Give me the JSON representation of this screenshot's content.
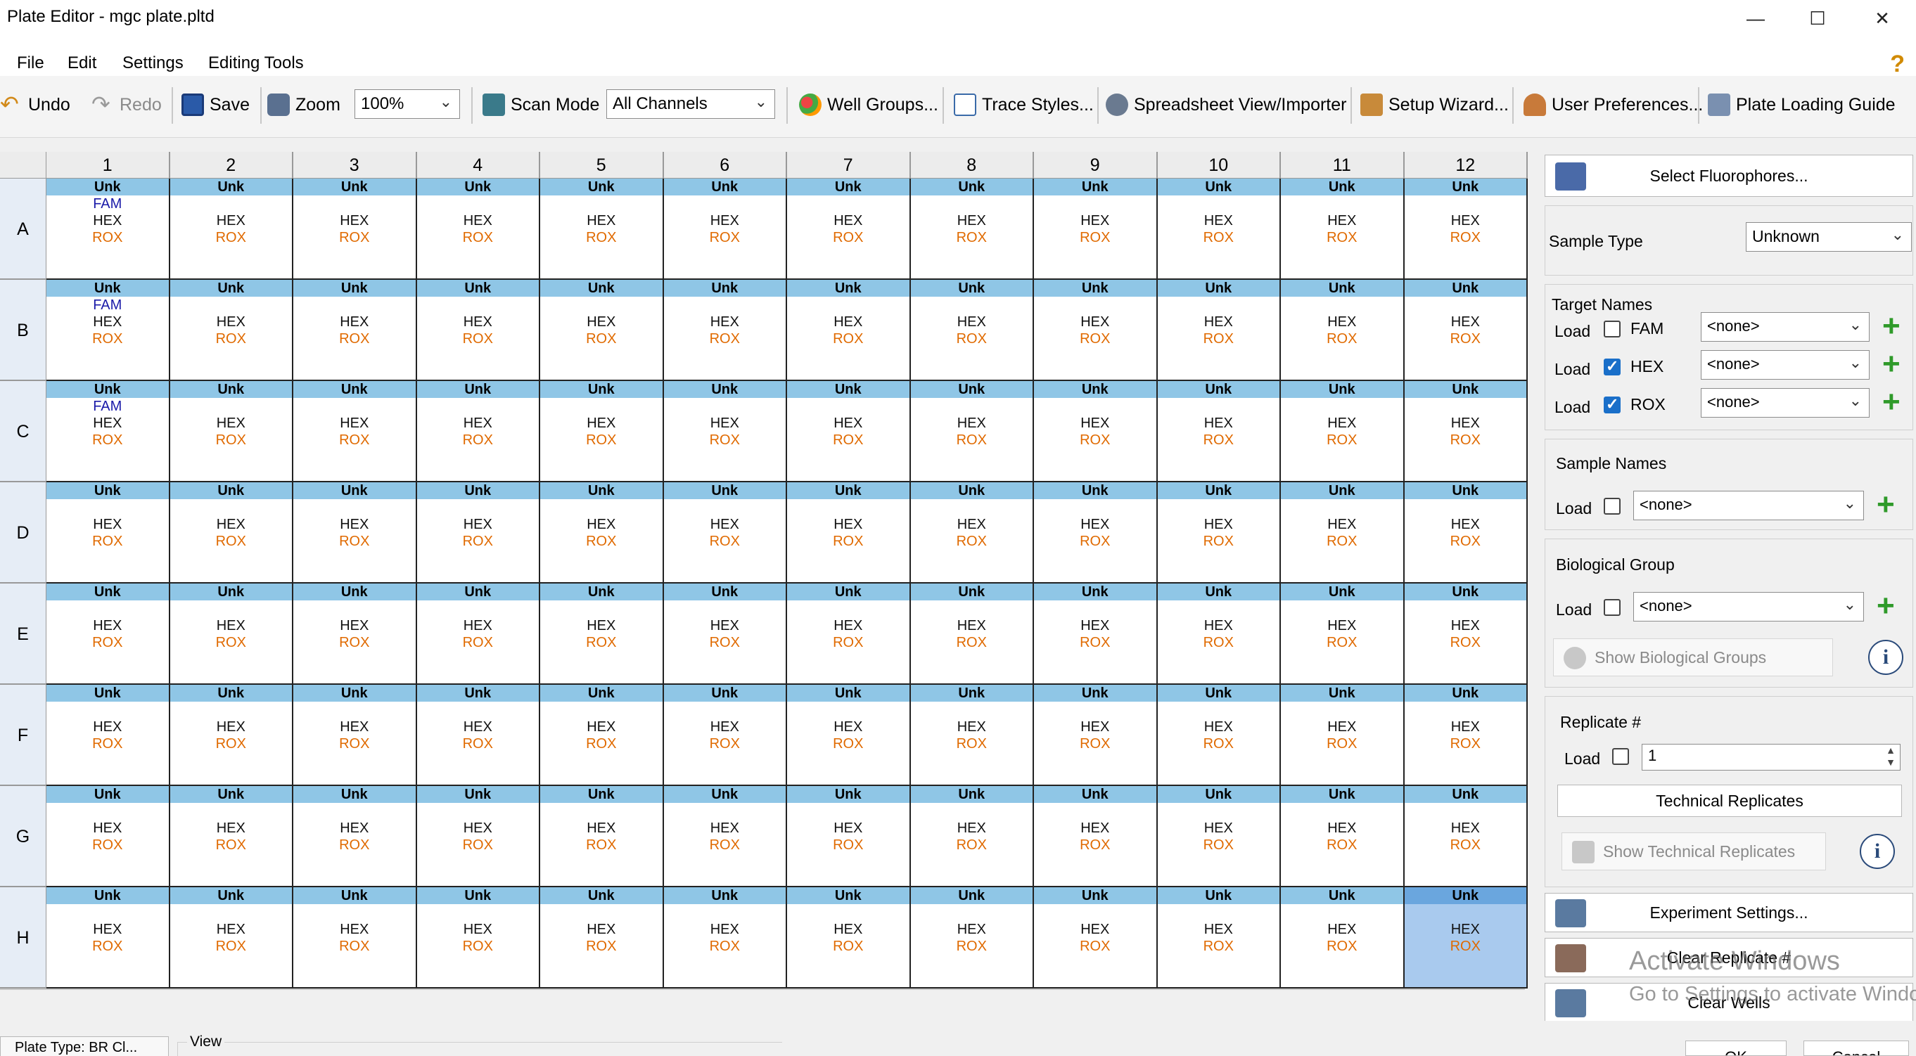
{
  "window": {
    "title": "Plate Editor - mgc plate.pltd"
  },
  "menu": [
    "File",
    "Edit",
    "Settings",
    "Editing Tools"
  ],
  "toolbar": {
    "undo": "Undo",
    "redo": "Redo",
    "save": "Save",
    "zoom": "Zoom",
    "zoom_value": "100%",
    "scan_mode": "Scan Mode",
    "scan_value": "All Channels",
    "well_groups": "Well Groups...",
    "trace_styles": "Trace Styles...",
    "spreadsheet": "Spreadsheet View/Importer",
    "setup_wizard": "Setup Wizard...",
    "user_prefs": "User Preferences...",
    "loading_guide": "Plate Loading Guide"
  },
  "plate": {
    "columns": [
      "1",
      "2",
      "3",
      "4",
      "5",
      "6",
      "7",
      "8",
      "9",
      "10",
      "11",
      "12"
    ],
    "rows": [
      "A",
      "B",
      "C",
      "D",
      "E",
      "F",
      "G",
      "H"
    ],
    "well_type": "Unk",
    "targets": [
      "FAM",
      "HEX",
      "ROX"
    ],
    "fam_wells": [
      "A1",
      "B1",
      "C1"
    ],
    "selected": [
      "H12"
    ]
  },
  "panel": {
    "select_fluorophores": "Select Fluorophores...",
    "sample_type_label": "Sample Type",
    "sample_type_value": "Unknown",
    "target_names_label": "Target Names",
    "load": "Load",
    "targets": [
      {
        "name": "FAM",
        "checked": false,
        "value": "<none>"
      },
      {
        "name": "HEX",
        "checked": true,
        "value": "<none>"
      },
      {
        "name": "ROX",
        "checked": true,
        "value": "<none>"
      }
    ],
    "sample_names_label": "Sample Names",
    "sample_names_value": "<none>",
    "bio_group_label": "Biological Group",
    "bio_group_value": "<none>",
    "show_bio_groups": "Show Biological Groups",
    "replicate_label": "Replicate #",
    "replicate_value": "1",
    "technical_replicates": "Technical Replicates",
    "show_tech_replicates": "Show Technical Replicates",
    "experiment_settings": "Experiment Settings...",
    "clear_replicate": "Clear Replicate #",
    "clear_wells": "Clear Wells"
  },
  "bottom": {
    "tab": "Plate Type: BR Cl...",
    "view_label": "View",
    "ok": "OK",
    "cancel": "Cancel"
  },
  "watermark": {
    "line1": "Activate Windows",
    "line2": "Go to Settings to activate Windows."
  },
  "colors": {
    "header_band": "#8fc6e6",
    "selected": "#a9caee",
    "rox": "#e06a00",
    "fam": "#1a1aa8",
    "plus": "#2f9a2a"
  }
}
